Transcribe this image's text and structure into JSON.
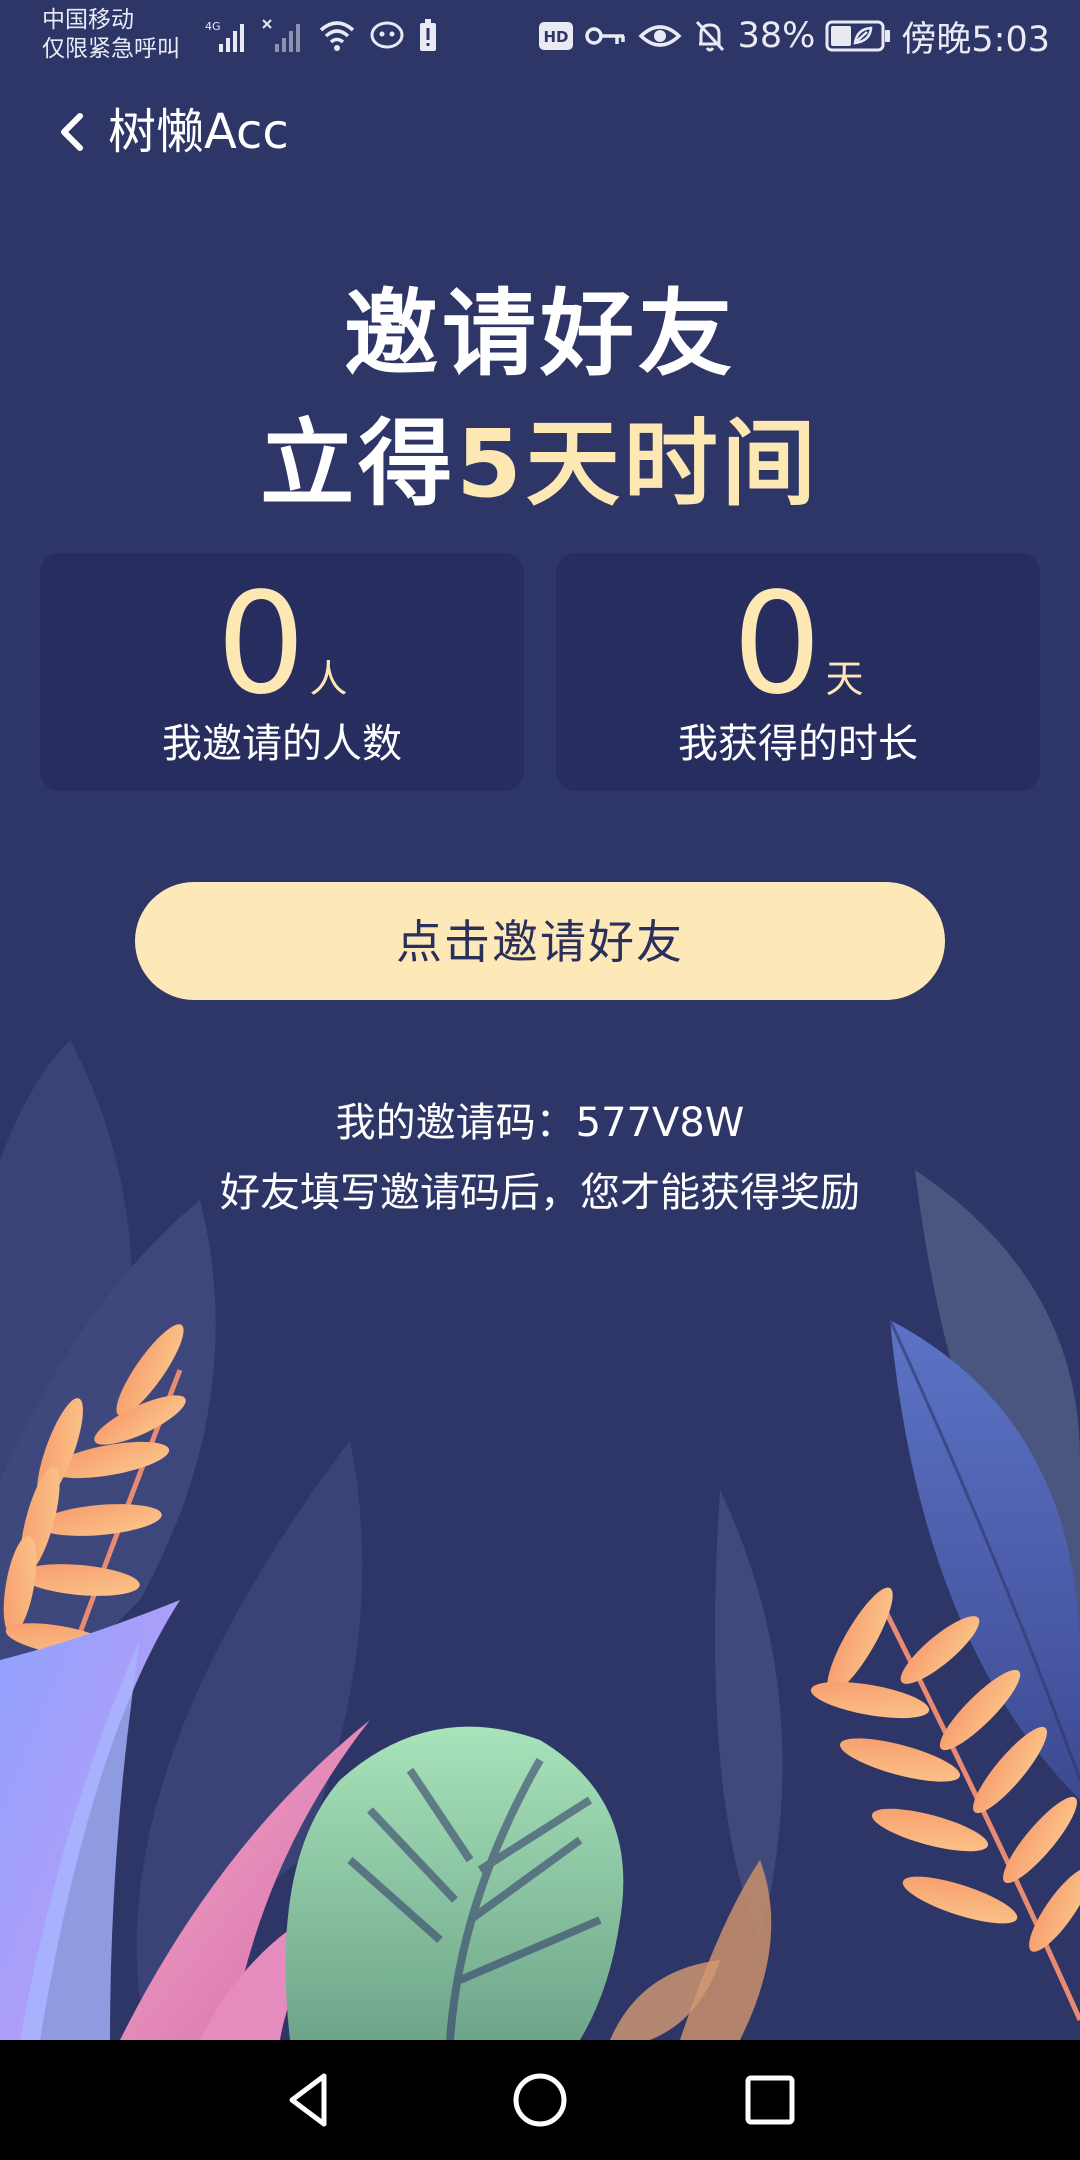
{
  "status_bar": {
    "carrier_line1": "中国移动",
    "carrier_line2": "仅限紧急呼叫",
    "network": "4G",
    "battery": "38%",
    "time": "傍晚5:03",
    "hd_label": "HD"
  },
  "header": {
    "title": "树懒Acc"
  },
  "hero": {
    "line1": "邀请好友",
    "line2_prefix": "立得",
    "line2_highlight": "5天时间"
  },
  "stats": [
    {
      "value": "0",
      "unit": "人",
      "label": "我邀请的人数"
    },
    {
      "value": "0",
      "unit": "天",
      "label": "我获得的时长"
    }
  ],
  "invite_button": "点击邀请好友",
  "invite_code": {
    "label": "我的邀请码：",
    "code": "577V8W"
  },
  "hint": "好友填写邀请码后，您才能获得奖励",
  "colors": {
    "background": "#2e3567",
    "accent_gold": "#fde8b4",
    "card": "#272d5f"
  }
}
